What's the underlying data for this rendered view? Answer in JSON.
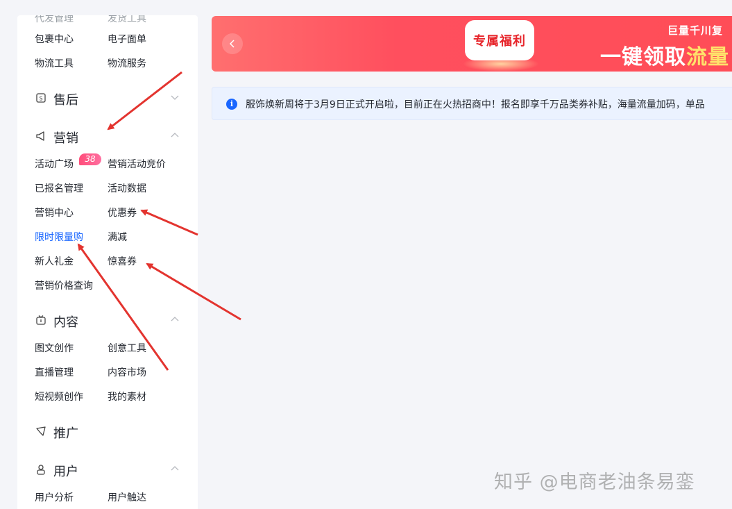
{
  "sidebar": {
    "top_row": [
      "代发管理",
      "发货工具"
    ],
    "rows_a": [
      [
        "包裹中心",
        "电子面单"
      ],
      [
        "物流工具",
        "物流服务"
      ]
    ],
    "sections": {
      "aftersale": {
        "title": "售后",
        "expanded": false
      },
      "marketing": {
        "title": "营销",
        "expanded": true,
        "badge": "38",
        "items": [
          [
            "活动广场",
            "营销活动竞价"
          ],
          [
            "已报名管理",
            "活动数据"
          ],
          [
            "营销中心",
            "优惠券"
          ],
          [
            "限时限量购",
            "满减"
          ],
          [
            "新人礼金",
            "惊喜券"
          ],
          [
            "营销价格查询",
            ""
          ]
        ],
        "active_item": "限时限量购"
      },
      "content": {
        "title": "内容",
        "expanded": true,
        "items": [
          [
            "图文创作",
            "创意工具"
          ],
          [
            "直播管理",
            "内容市场"
          ],
          [
            "短视频创作",
            "我的素材"
          ]
        ]
      },
      "promotion": {
        "title": "推广"
      },
      "user": {
        "title": "用户",
        "expanded": true,
        "items": [
          [
            "用户分析",
            "用户触达"
          ]
        ]
      }
    }
  },
  "banner": {
    "card_text": "专属福利",
    "small_text": "巨量千川复",
    "big_text_white": "一键领取",
    "big_text_highlight": "流量"
  },
  "notice": {
    "text": "服饰焕新周将于3月9日正式开启啦，目前正在火热招商中！报名即享千万品类券补贴，海量流量加码，单品"
  },
  "watermark": "知乎 @电商老油条易銮",
  "colors": {
    "accent": "#1966ff",
    "banner_red": "#ff4d57",
    "arrow_red": "#e3342f",
    "badge_pink": "#ff4d7a"
  }
}
